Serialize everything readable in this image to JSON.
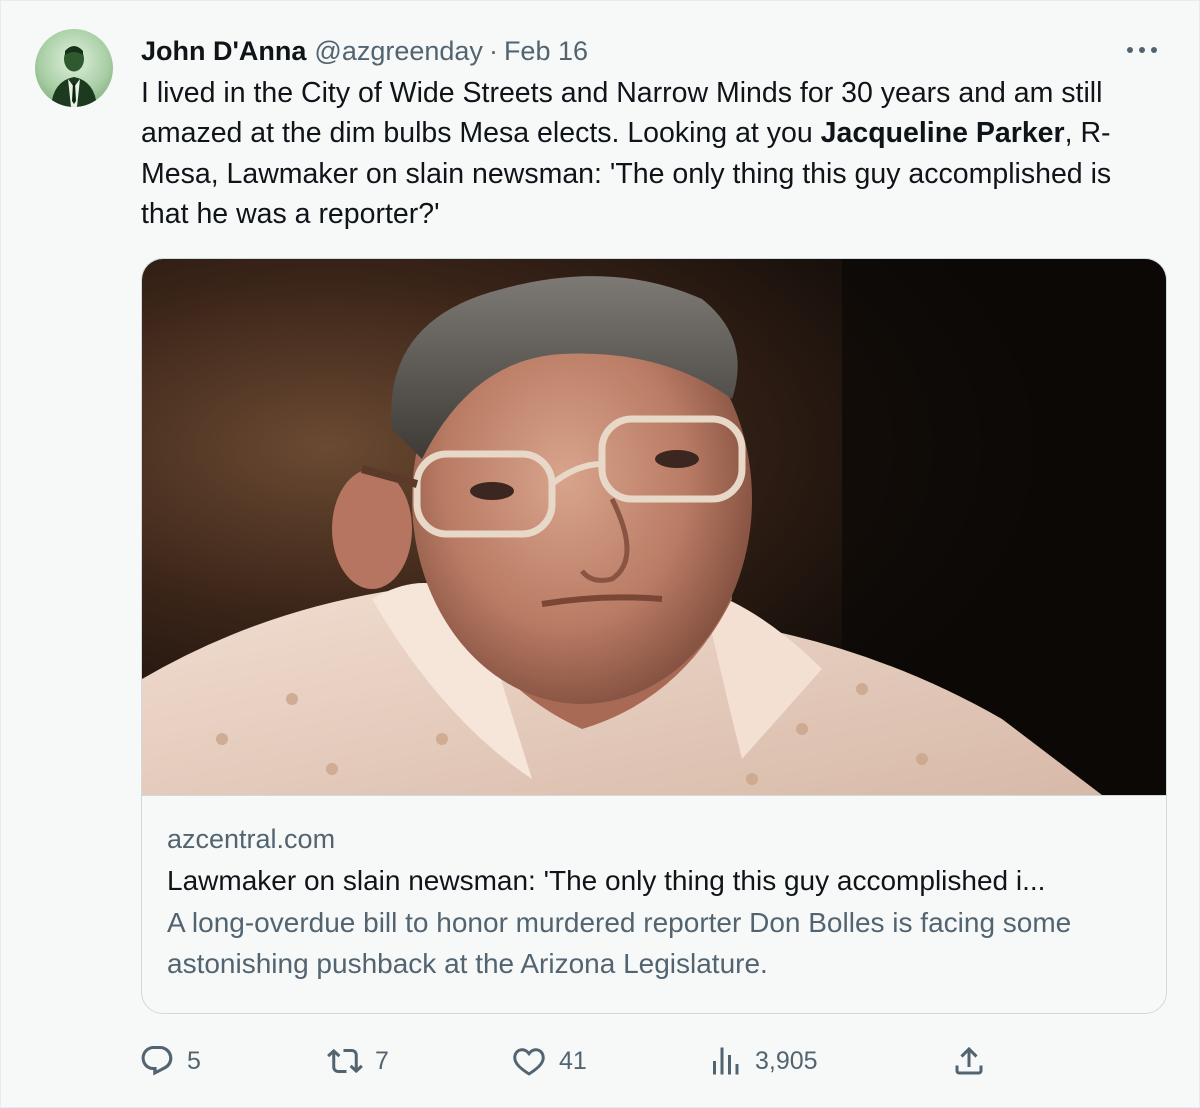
{
  "author": {
    "name": "John D'Anna",
    "handle": "@azgreenday",
    "separator": "·",
    "date": "Feb 16"
  },
  "tweet": {
    "text_part1": "I lived in the City of Wide Streets and Narrow Minds for 30 years and am still amazed at the dim bulbs Mesa elects. Looking at you ",
    "mention": "Jacqueline Parker",
    "text_part2": ", R-Mesa, Lawmaker on slain newsman: 'The only thing this guy accomplished is that he was a reporter?'"
  },
  "link_card": {
    "domain": "azcentral.com",
    "title": "Lawmaker on slain newsman: 'The only thing this guy accomplished i...",
    "description": "A long-overdue bill to honor murdered reporter Don Bolles is facing some astonishing pushback at the Arizona Legislature."
  },
  "actions": {
    "replies": "5",
    "retweets": "7",
    "likes": "41",
    "views": "3,905"
  },
  "icons": {
    "more": "more-horizontal-icon",
    "reply": "reply-icon",
    "retweet": "retweet-icon",
    "like": "heart-icon",
    "views": "views-bar-chart-icon",
    "share": "share-icon"
  },
  "colors": {
    "primary_text": "#0f1419",
    "secondary_text": "#536471",
    "border": "#cfd9de",
    "background": "#f7f9f9"
  }
}
